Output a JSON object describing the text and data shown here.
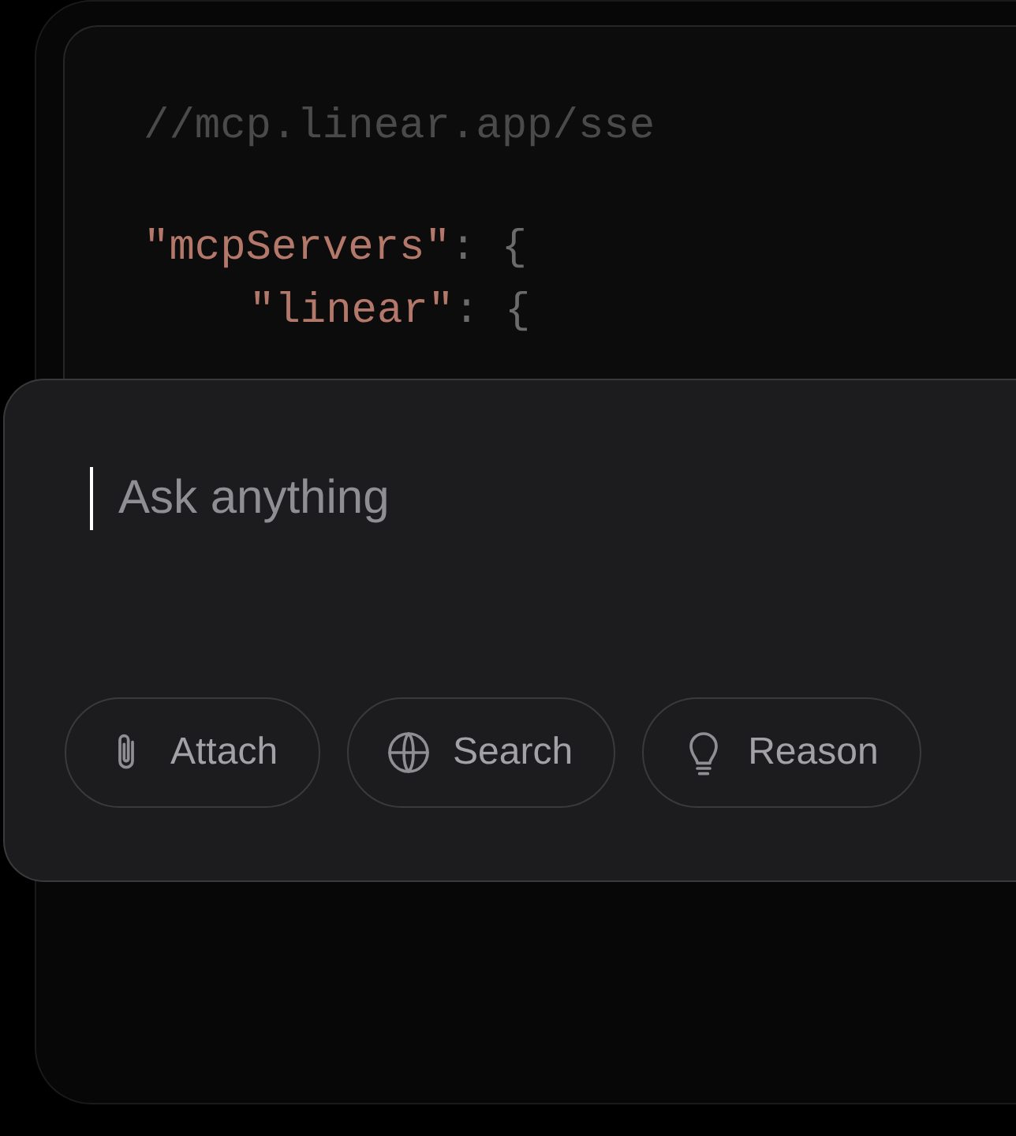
{
  "code_card": {
    "comment": "//mcp.linear.app/sse",
    "code": [
      {
        "tokens": [
          {
            "text": "\"mcpServers\"",
            "kind": "key"
          },
          {
            "text": ": {",
            "kind": "punct"
          }
        ],
        "children": [
          {
            "tokens": [
              {
                "text": "\"linear\"",
                "kind": "key"
              },
              {
                "text": ": {",
                "kind": "punct"
              }
            ]
          }
        ]
      }
    ]
  },
  "composer": {
    "placeholder": "Ask anything",
    "buttons": [
      {
        "label": "Attach",
        "kind": "attach"
      },
      {
        "label": "Search",
        "kind": "search"
      },
      {
        "label": "Reason",
        "kind": "reason"
      }
    ]
  }
}
